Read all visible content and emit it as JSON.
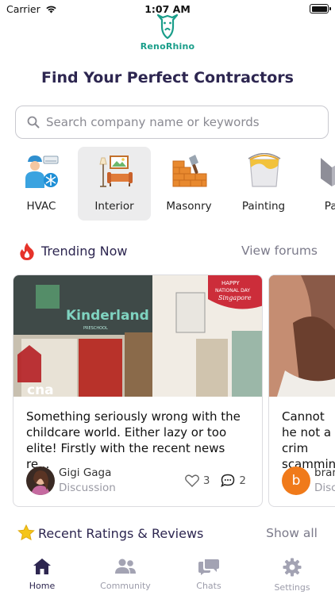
{
  "status_bar": {
    "carrier": "Carrier",
    "time": "1:07 AM"
  },
  "app": {
    "name": "RenoRhino",
    "logo_icon": "rhino-logo-icon",
    "accent": "#1a9e8a"
  },
  "page_title": "Find Your Perfect Contractors",
  "search": {
    "placeholder": "Search company name or keywords",
    "value": ""
  },
  "categories": [
    {
      "label": "HVAC",
      "icon": "hvac-icon",
      "selected": false
    },
    {
      "label": "Interior",
      "icon": "interior-icon",
      "selected": true
    },
    {
      "label": "Masonry",
      "icon": "masonry-icon",
      "selected": false
    },
    {
      "label": "Painting",
      "icon": "painting-icon",
      "selected": false
    },
    {
      "label": "Parti",
      "icon": "partition-icon",
      "selected": false
    }
  ],
  "trending": {
    "title": "Trending Now",
    "icon": "flame-icon",
    "link": "View forums",
    "cards": [
      {
        "image_text": {
          "sign": "Kinderland",
          "sign_sub": "PRESCHOOL",
          "banner_line1": "HAPPY",
          "banner_line2": "NATIONAL DAY",
          "banner_line3": "Singapore",
          "corner_logo": "cna"
        },
        "text": "Something seriously wrong with the childcare world. Either lazy or too elite! Firstly with the recent news re...",
        "author": "Gigi Gaga",
        "type": "Discussion",
        "likes": "3",
        "comments": "2"
      },
      {
        "text": "Cannot he not a crim scamming",
        "author": "bran",
        "avatar_letter": "b",
        "type": "Disc"
      }
    ]
  },
  "reviews": {
    "title": "Recent Ratings & Reviews",
    "icon": "star-icon",
    "link": "Show all"
  },
  "tabs": [
    {
      "label": "Home",
      "icon": "home-icon",
      "active": true
    },
    {
      "label": "Community",
      "icon": "community-icon",
      "active": false
    },
    {
      "label": "Chats",
      "icon": "chats-icon",
      "active": false
    },
    {
      "label": "Settings",
      "icon": "gear-icon",
      "active": false
    }
  ]
}
